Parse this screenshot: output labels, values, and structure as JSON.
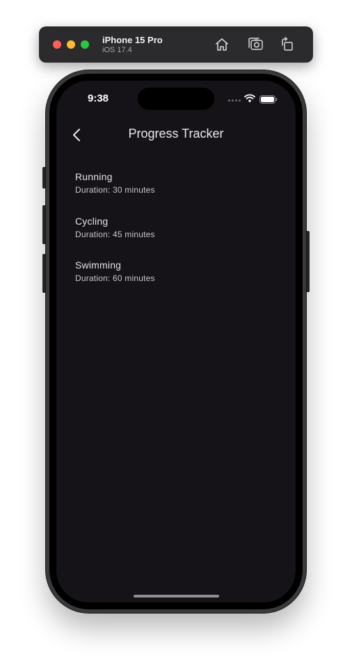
{
  "simulator": {
    "device_name": "iPhone 15 Pro",
    "os_version": "iOS 17.4",
    "toolbar_icons": [
      "home-icon",
      "screenshot-icon",
      "rotate-icon"
    ]
  },
  "status_bar": {
    "time": "9:38"
  },
  "app_bar": {
    "back_icon": "chevron-left-icon",
    "title": "Progress Tracker"
  },
  "activities": [
    {
      "name": "Running",
      "duration": "Duration: 30 minutes"
    },
    {
      "name": "Cycling",
      "duration": "Duration: 45 minutes"
    },
    {
      "name": "Swimming",
      "duration": "Duration: 60 minutes"
    }
  ],
  "colors": {
    "screen_background": "#151318",
    "title_text": "#ece6f0",
    "subtitle_text": "#cac4d0",
    "toolbar_background": "#2b2b2d"
  }
}
